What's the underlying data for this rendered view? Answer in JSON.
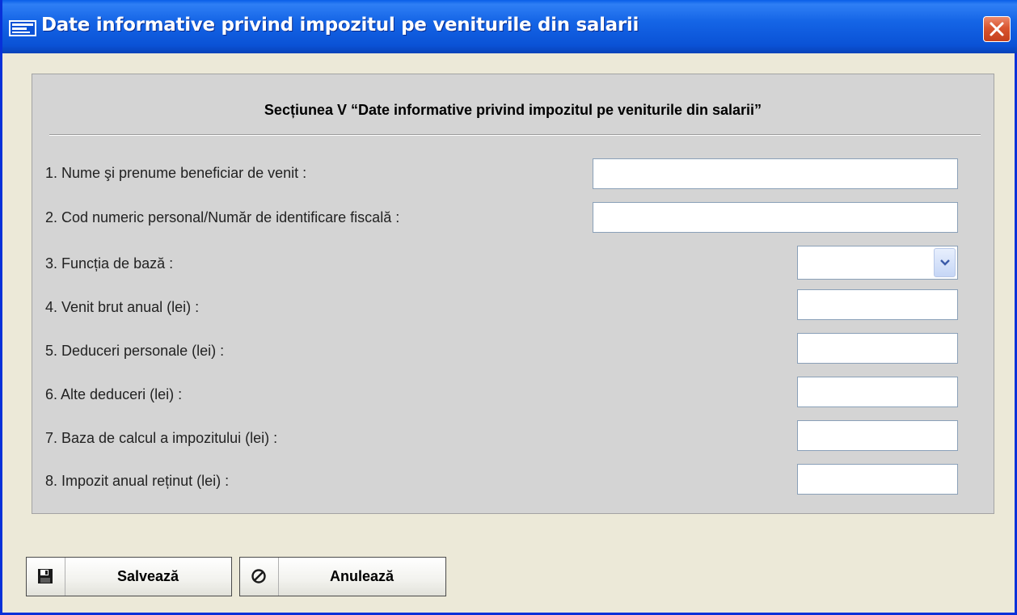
{
  "window": {
    "title": "Date informative privind impozitul pe veniturile din salarii",
    "app_icon": "form-window-icon",
    "close_icon": "close-icon"
  },
  "section": {
    "title": "Secțiunea V “Date informative privind impozitul pe veniturile din salarii”"
  },
  "fields": {
    "beneficiary_name": {
      "label": "1. Nume şi prenume beneficiar de venit :",
      "value": ""
    },
    "cnp": {
      "label": "2. Cod numeric personal/Număr de identificare fiscală :",
      "value": ""
    },
    "base_function": {
      "label": "3. Funcția de bază :",
      "value": "",
      "icon": "chevron-down-icon"
    },
    "gross_income": {
      "label": "4. Venit brut anual (lei) :",
      "value": ""
    },
    "personal_deductions": {
      "label": "5. Deduceri personale (lei) :",
      "value": ""
    },
    "other_deductions": {
      "label": "6. Alte deduceri (lei) :",
      "value": ""
    },
    "tax_base": {
      "label": "7. Baza de calcul a impozitului (lei) :",
      "value": ""
    },
    "annual_tax": {
      "label": "8. Impozit anual reținut (lei) :",
      "value": ""
    }
  },
  "buttons": {
    "save": {
      "label": "Salvează",
      "icon": "floppy-disk-icon"
    },
    "cancel": {
      "label": "Anulează",
      "icon": "cancel-circle-icon"
    }
  },
  "colors": {
    "titlebar": "#0a52d6",
    "window_bg": "#ece9d8",
    "panel_bg": "#d4d4d4",
    "close_button": "#d9552f"
  }
}
